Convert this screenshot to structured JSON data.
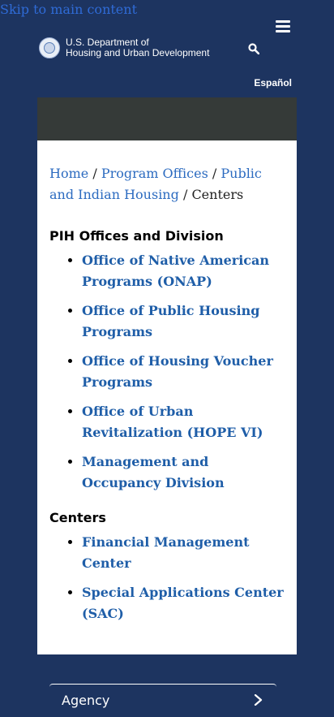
{
  "skip_link": "Skip to main content",
  "header": {
    "agency_line1": "U.S. Department of",
    "agency_line2": "Housing and Urban Development",
    "language_link": "Español"
  },
  "icons": {
    "menu": "hamburger-menu-icon",
    "search": "search-icon",
    "seal": "hud-seal-logo",
    "accordion": "chevron-right-icon"
  },
  "breadcrumb": {
    "items": [
      "Home",
      "Program Offices",
      "Public and Indian Housing"
    ],
    "current": "Centers",
    "separator": "/"
  },
  "sections": [
    {
      "title": "PIH Offices and Division",
      "links": [
        "Office of Native American Programs (ONAP)",
        "Office of Public Housing Programs",
        "Office of Housing Voucher Programs",
        "Office of Urban Revitalization (HOPE VI)",
        "Management and Occupancy Division"
      ]
    },
    {
      "title": "Centers",
      "links": [
        "Financial Management Center",
        "Special Applications Center (SAC)"
      ]
    }
  ],
  "footer_nav": {
    "accordion_label": "Agency"
  },
  "colors": {
    "page_background": "#1d3460",
    "link": "#1f5ea8",
    "band": "#353a38"
  }
}
